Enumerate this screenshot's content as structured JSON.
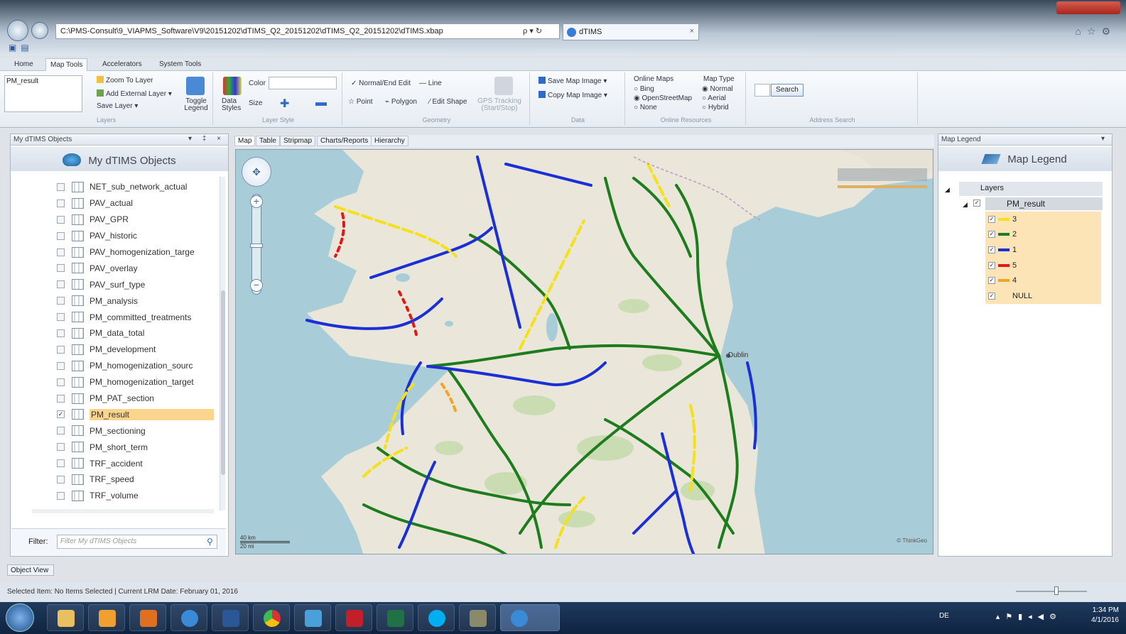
{
  "browser": {
    "address": "C:\\PMS-Consult\\9_VIAPMS_Software\\V9\\20151202\\dTIMS_Q2_20151202\\dTIMS_Q2_20151202\\dTIMS.xbap",
    "addr_controls": "ρ ▾ ↻",
    "tab_title": "dTIMS",
    "tab_close": "×"
  },
  "ribbon": {
    "tabs": [
      "Home",
      "Map Tools",
      "Accelerators",
      "System Tools"
    ],
    "active_tab": "Map Tools",
    "layer_listbox_value": "PM_result",
    "layers_group": {
      "zoom": "Zoom To Layer",
      "add_external": "Add External Layer",
      "save": "Save Layer",
      "toggle_legend": "Toggle Legend",
      "name": "Layers"
    },
    "layer_style_group": {
      "data_styles": "Data Styles",
      "color": "Color",
      "size": "Size",
      "name": "Layer Style"
    },
    "geometry_group": {
      "normal_end_edit": "Normal/End Edit",
      "line": "Line",
      "point": "Point",
      "polygon": "Polygon",
      "edit_shape": "Edit Shape",
      "gps": "GPS Tracking (Start/Stop)",
      "name": "Geometry"
    },
    "data_group": {
      "save_map_image": "Save Map Image",
      "copy_map_image": "Copy Map Image",
      "name": "Data"
    },
    "online_group": {
      "online_maps": "Online Maps",
      "bing": "Bing",
      "osm": "OpenStreetMap",
      "none": "None",
      "map_type": "Map Type",
      "normal": "Normal",
      "aerial": "Aerial",
      "hybrid": "Hybrid",
      "name": "Online Resources"
    },
    "address_group": {
      "search": "Search",
      "name": "Address Search"
    }
  },
  "objects_panel": {
    "title": "My dTIMS Objects",
    "header": "My dTIMS Objects",
    "controls": "▾ ‡ ×",
    "items": [
      {
        "name": "NET_sub_network_actual",
        "checked": false
      },
      {
        "name": "PAV_actual",
        "checked": false
      },
      {
        "name": "PAV_GPR",
        "checked": false
      },
      {
        "name": "PAV_historic",
        "checked": false
      },
      {
        "name": "PAV_homogenization_targe",
        "checked": false
      },
      {
        "name": "PAV_overlay",
        "checked": false
      },
      {
        "name": "PAV_surf_type",
        "checked": false
      },
      {
        "name": "PM_analysis",
        "checked": false
      },
      {
        "name": "PM_committed_treatments",
        "checked": false
      },
      {
        "name": "PM_data_total",
        "checked": false
      },
      {
        "name": "PM_development",
        "checked": false
      },
      {
        "name": "PM_homogenization_sourc",
        "checked": false
      },
      {
        "name": "PM_homogenization_target",
        "checked": false
      },
      {
        "name": "PM_PAT_section",
        "checked": false
      },
      {
        "name": "PM_result",
        "checked": true
      },
      {
        "name": "PM_sectioning",
        "checked": false
      },
      {
        "name": "PM_short_term",
        "checked": false
      },
      {
        "name": "TRF_accident",
        "checked": false
      },
      {
        "name": "TRF_speed",
        "checked": false
      },
      {
        "name": "TRF_volume",
        "checked": false
      }
    ],
    "filter_label": "Filter:",
    "filter_placeholder": "Filter My dTIMS Objects"
  },
  "map_tabs": [
    "Map",
    "Table",
    "Stripmap",
    "Charts/Reports",
    "Hierarchy"
  ],
  "map": {
    "city": "Dublin",
    "scale_top": "40 km",
    "scale_bottom": "20 mi",
    "credit": "© ThinkGeo"
  },
  "legend_panel": {
    "title": "Map Legend",
    "header": "Map Legend",
    "layers_label": "Layers",
    "layer_name": "PM_result",
    "items": [
      {
        "label": "3",
        "color": "#f4e11a"
      },
      {
        "label": "2",
        "color": "#1d7d1d"
      },
      {
        "label": "1",
        "color": "#1a2fd6"
      },
      {
        "label": "5",
        "color": "#e01818"
      },
      {
        "label": "4",
        "color": "#f0a52a"
      },
      {
        "label": "NULL",
        "color": "#fde4b7"
      }
    ]
  },
  "object_view_tab": "Object View",
  "status": {
    "text": "Selected Item:  No Items Selected  |  Current LRM Date: February 01, 2016"
  },
  "taskbar": {
    "lang": "DE",
    "time": "1:34 PM",
    "date": "4/1/2016"
  }
}
